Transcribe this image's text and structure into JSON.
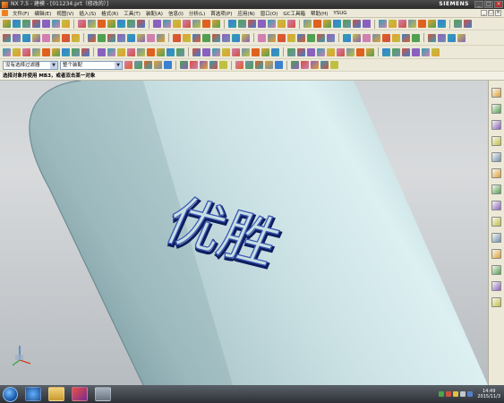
{
  "window": {
    "title": "NX 7.5 - 建模 - [011234.prt（修改的）]",
    "brand": "SIEMENS",
    "minimize": "_",
    "maximize": "□",
    "close": "×"
  },
  "menu": {
    "items": [
      "文件(F)",
      "编辑(E)",
      "视图(V)",
      "插入(S)",
      "格式(R)",
      "工具(T)",
      "装配(A)",
      "信息(I)",
      "分析(L)",
      "首选项(P)",
      "应用(N)",
      "窗口(O)",
      "GC工具箱",
      "帮助(H)",
      "YSUG"
    ]
  },
  "toolbar": {
    "selection_filter": "没有选择过滤器",
    "assembly_scope": "整个装配"
  },
  "cue_line": "选择对象并使用 MB3，或者双击某一对象",
  "model": {
    "text": "优胜"
  },
  "taskbar": {
    "time": "14:49",
    "date": "2015/11/3"
  },
  "colors": {
    "cylinder_light": "#dbeef0",
    "cylinder_mid": "#b6d0d3",
    "cylinder_shadow": "#7fa2a8",
    "text_edge": "#1a2a7a"
  }
}
